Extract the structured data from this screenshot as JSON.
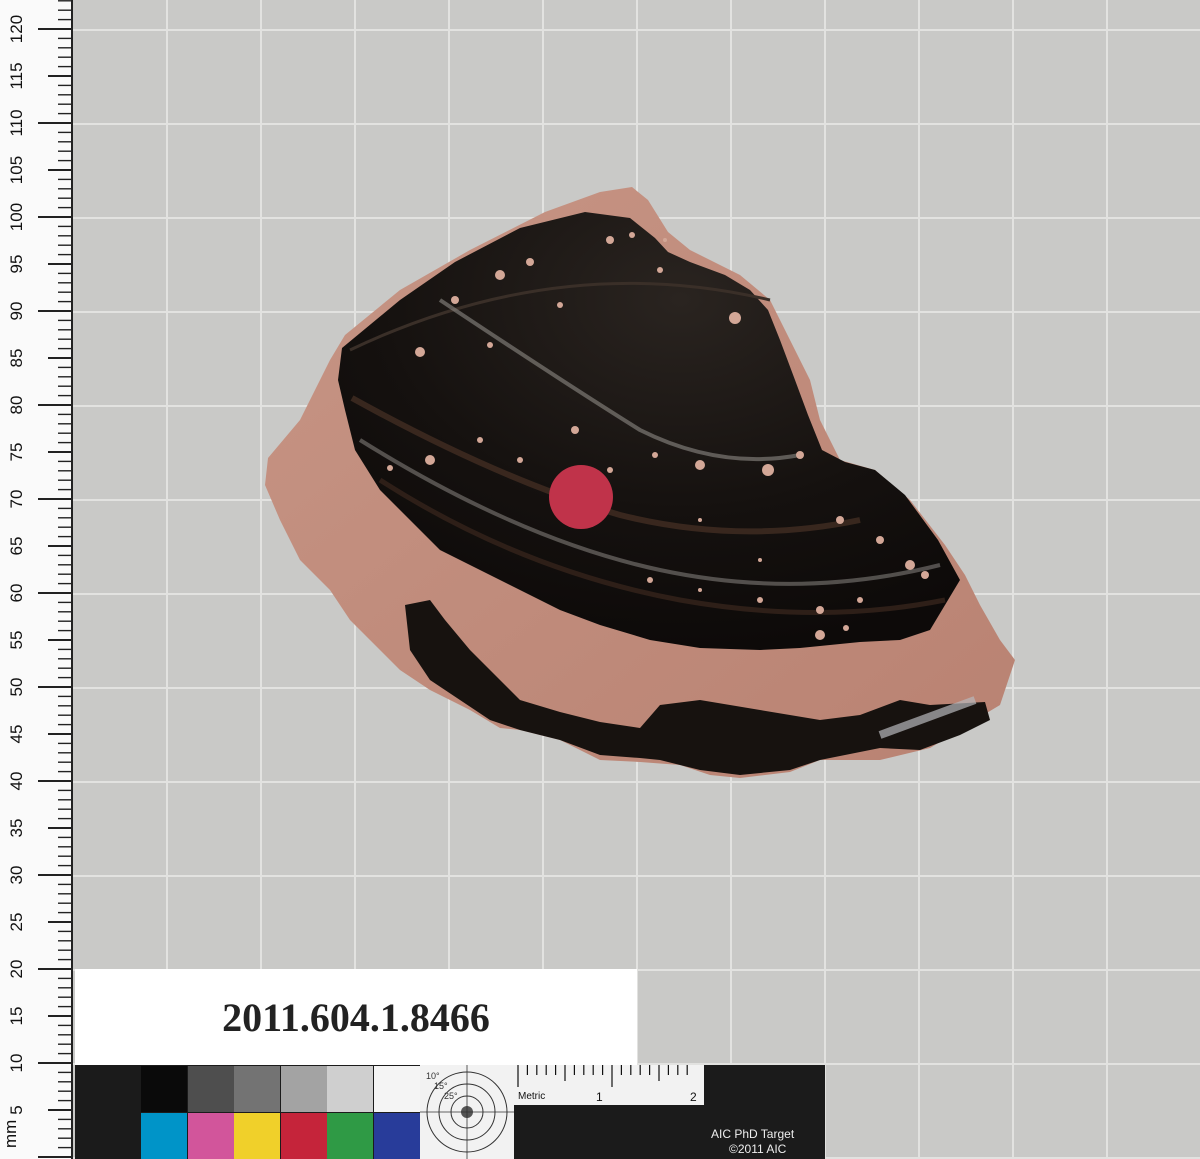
{
  "ruler": {
    "unit_label": "mm",
    "tick_labels": [
      "5",
      "10",
      "15",
      "20",
      "25",
      "30",
      "35",
      "40",
      "45",
      "50",
      "55",
      "60",
      "65",
      "70",
      "75",
      "80",
      "85",
      "90",
      "95",
      "100",
      "105",
      "110",
      "115",
      "120"
    ]
  },
  "label": {
    "accession_number": "2011.604.1.8466"
  },
  "target": {
    "metric_label": "Metric",
    "scale_1": "1",
    "scale_2": "2",
    "ring_10": "10°",
    "ring_15": "15°",
    "ring_25": "25°",
    "name": "AIC PhD Target",
    "copyright": "©2011 AIC",
    "swatches_top": [
      "#0a0a0a",
      "#4e4e4e",
      "#737373",
      "#a3a3a3",
      "#cfcfcf",
      "#f4f4f4"
    ],
    "swatches_bottom": [
      "#0094c8",
      "#d2559b",
      "#f0d02a",
      "#c5243a",
      "#2f9a45",
      "#283c9a"
    ]
  },
  "colors": {
    "background": "#c9c9c7",
    "grid_line": "#e2e2e0",
    "terracotta": "#c58f7e",
    "glaze": "#1a1512",
    "red_dot": "#c0334a"
  }
}
